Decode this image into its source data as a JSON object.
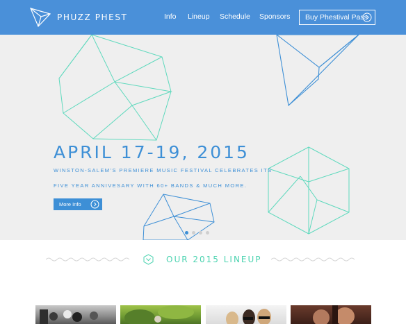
{
  "header": {
    "brand": "PHUZZ PHEST",
    "nav": [
      "Info",
      "Lineup",
      "Schedule",
      "Sponsors"
    ],
    "cta_label": "Buy Phestival Pass"
  },
  "hero": {
    "title": "APRIL 17-19, 2015",
    "subtitle_line1": "WINSTON-SALEM’S PREMIERE MUSIC FESTIVAL CELEBRATES ITS",
    "subtitle_line2": "FIVE YEAR ANNIVESARY WITH 60+ BANDS & MUCH MORE.",
    "button_label": "More Info",
    "slides": 4,
    "active_slide": 1
  },
  "lineup": {
    "title": "OUR 2015 LINEUP"
  },
  "colors": {
    "header_bg": "#4a90d9",
    "accent_blue": "#3d8fd6",
    "accent_teal": "#4cd3b0",
    "hero_bg": "#efefef"
  },
  "icons": [
    "paper-plane-logo-icon",
    "chevron-right-circle-icon",
    "hexagon-chevron-down-icon"
  ]
}
